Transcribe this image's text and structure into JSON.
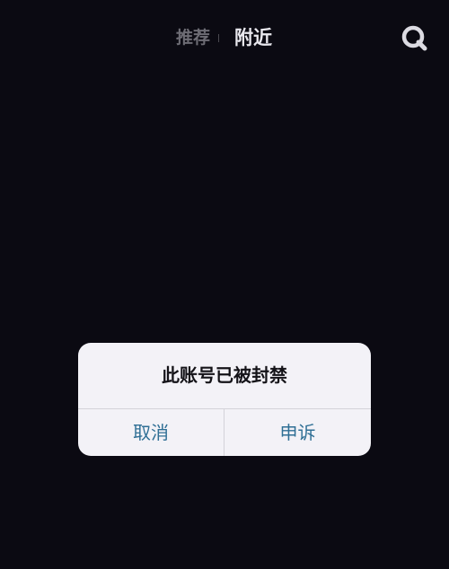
{
  "top_nav": {
    "tabs": [
      {
        "label": "推荐",
        "active": false
      },
      {
        "label": "附近",
        "active": true
      }
    ],
    "search_icon": "search-icon"
  },
  "dialog": {
    "message": "此账号已被封禁",
    "buttons": {
      "cancel": "取消",
      "appeal": "申诉"
    }
  },
  "colors": {
    "background": "#0b0a12",
    "active_tab": "#e9e8ee",
    "inactive_tab": "#6d6c74",
    "dialog_bg": "#f3f2f7",
    "button_text": "#2f6f95"
  }
}
